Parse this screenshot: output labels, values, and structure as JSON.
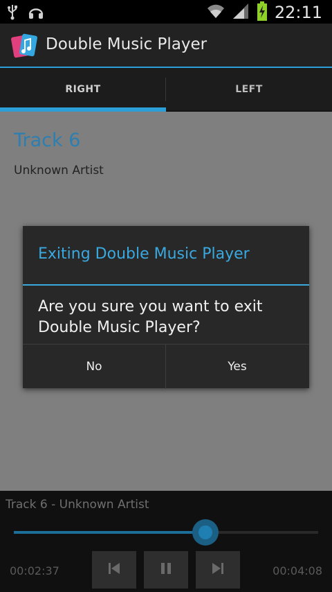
{
  "status_bar": {
    "time": "22:11",
    "icons": [
      "usb-icon",
      "headset-icon",
      "wifi-icon",
      "signal-icon",
      "battery-charging-icon"
    ]
  },
  "action_bar": {
    "title": "Double Music Player",
    "icon": "app-icon"
  },
  "tabs": [
    {
      "label": "RIGHT",
      "selected": true
    },
    {
      "label": "LEFT",
      "selected": false
    }
  ],
  "track": {
    "title": "Track 6",
    "artist": "Unknown Artist"
  },
  "dialog": {
    "title": "Exiting Double Music Player",
    "message": "Are you sure you want to exit Double Music Player?",
    "buttons": {
      "no": "No",
      "yes": "Yes"
    }
  },
  "player": {
    "now_playing": "Track 6 - Unknown Artist",
    "current_time": "00:02:37",
    "total_time": "00:04:08",
    "progress": 0.63,
    "controls": [
      "previous-icon",
      "pause-icon",
      "next-icon"
    ]
  },
  "colors": {
    "accent": "#2c9fd8",
    "dialog_bg": "#282828"
  }
}
